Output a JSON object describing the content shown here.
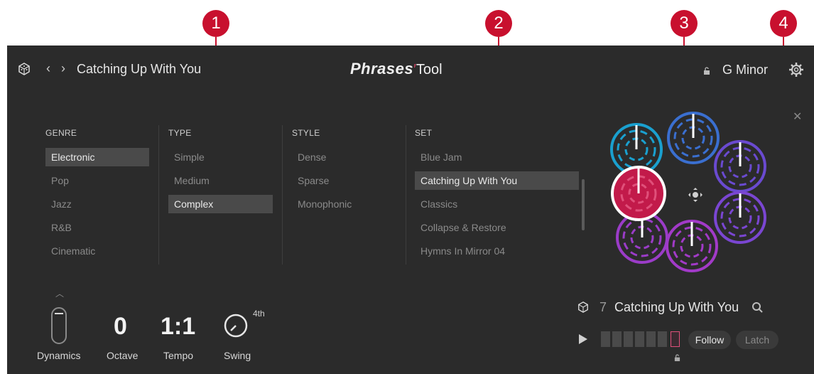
{
  "callouts": [
    "1",
    "2",
    "3",
    "4"
  ],
  "header": {
    "title": "Catching Up With You",
    "logo_main": "Phrases",
    "logo_tool": "Tool",
    "key": "G Minor"
  },
  "browser": {
    "genre": {
      "header": "GENRE",
      "items": [
        "Electronic",
        "Pop",
        "Jazz",
        "R&B",
        "Cinematic"
      ],
      "selected": "Electronic"
    },
    "type": {
      "header": "TYPE",
      "items": [
        "Simple",
        "Medium",
        "Complex"
      ],
      "selected": "Complex"
    },
    "style": {
      "header": "STYLE",
      "items": [
        "Dense",
        "Sparse",
        "Monophonic"
      ]
    },
    "set": {
      "header": "SET",
      "items": [
        "Blue Jam",
        "Catching Up With You",
        "Classics",
        "Collapse & Restore",
        "Hymns In Mirror 04"
      ],
      "selected": "Catching Up With You"
    }
  },
  "controls": {
    "dynamics_label": "Dynamics",
    "octave_value": "0",
    "octave_label": "Octave",
    "tempo_value": "1:1",
    "tempo_label": "Tempo",
    "swing_label": "Swing",
    "swing_sup": "4th"
  },
  "player": {
    "number": "7",
    "name": "Catching Up With You",
    "follow_label": "Follow",
    "latch_label": "Latch"
  },
  "colors": {
    "accent": "#c8102e",
    "panel": "#2b2b2b"
  },
  "icons": [
    "dice-icon",
    "chevron-left-icon",
    "chevron-right-icon",
    "lock-icon",
    "gear-icon",
    "close-icon",
    "move-icon",
    "search-icon",
    "play-icon",
    "chevron-up-icon"
  ]
}
